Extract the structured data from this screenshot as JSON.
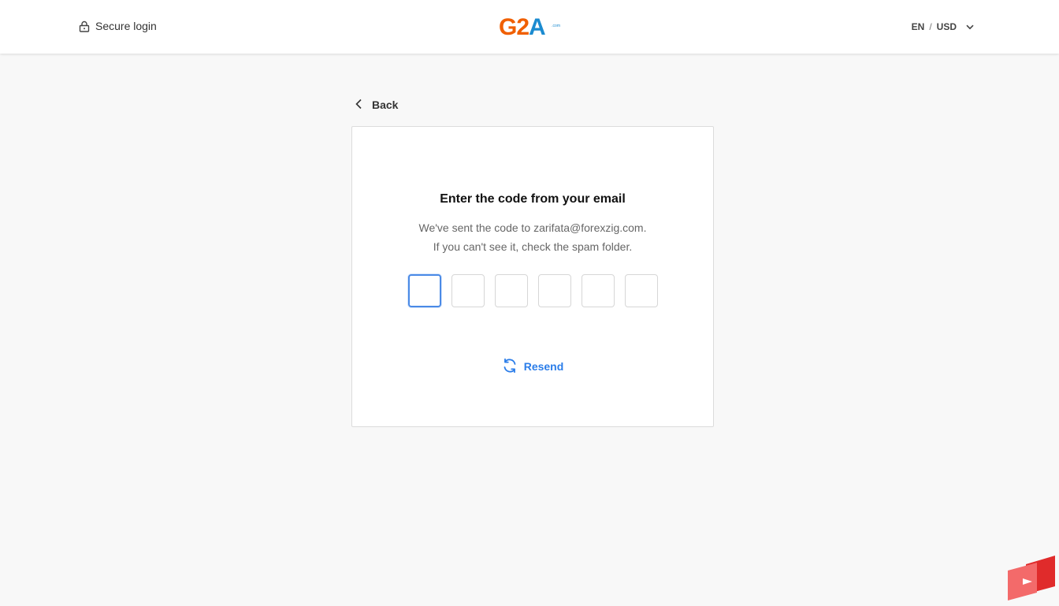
{
  "header": {
    "secure_label": "Secure login",
    "logo": {
      "g": "G",
      "two": "2",
      "a": "A",
      "com": ".com"
    },
    "locale": {
      "language": "EN",
      "separator": "/",
      "currency": "USD"
    }
  },
  "back_label": "Back",
  "card": {
    "title": "Enter the code from your email",
    "description_line1": "We've sent the code to zarifata@forexzig.com.",
    "description_line2": "If you can't see it, check the spam folder.",
    "code_digits": [
      "",
      "",
      "",
      "",
      "",
      ""
    ],
    "resend_label": "Resend"
  },
  "icons": {
    "lock": "lock-icon",
    "chevron_down": "chevron-down-icon",
    "chevron_left": "chevron-left-icon",
    "refresh": "refresh-icon"
  },
  "colors": {
    "brand_orange": "#f05f00",
    "brand_blue": "#1b8bd0",
    "accent_link": "#2b7de9",
    "focus_border": "#4a8ae6",
    "background": "#f8f8f8"
  }
}
